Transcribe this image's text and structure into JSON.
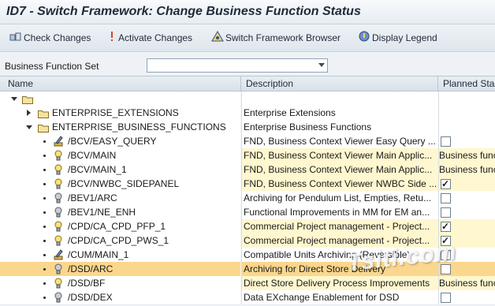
{
  "window": {
    "title": "ID7 - Switch Framework: Change Business Function Status"
  },
  "toolbar": {
    "check_changes": "Check Changes",
    "activate_changes": "Activate Changes",
    "switch_framework_browser": "Switch Framework Browser",
    "display_legend": "Display Legend"
  },
  "bfset": {
    "label": "Business Function Set",
    "value": ""
  },
  "columns": {
    "name": "Name",
    "description": "Description",
    "planned_status": "Planned Sta"
  },
  "tree": {
    "root": {
      "name": "",
      "description": ""
    },
    "enterprise_extensions": {
      "name": "ENTERPRISE_EXTENSIONS",
      "description": "Enterprise Extensions"
    },
    "enterprise_business_functions": {
      "name": "ENTERPRISE_BUSINESS_FUNCTIONS",
      "description": "Enterprise Business Functions"
    }
  },
  "rows": [
    {
      "name": "/BCV/EASY_QUERY",
      "icon": "pencil-icon",
      "description": "FND, Business Context Viewer Easy Query ...",
      "planned": "",
      "checked": false,
      "style": "white"
    },
    {
      "name": "/BCV/MAIN",
      "icon": "bulb-icon",
      "description": "FND, Business Context Viewer Main Applic...",
      "planned": "Business func",
      "checked": null,
      "style": "yellow"
    },
    {
      "name": "/BCV/MAIN_1",
      "icon": "bulb-icon",
      "description": "FND, Business Context Viewer Main Applic...",
      "planned": "Business func",
      "checked": null,
      "style": "yellow"
    },
    {
      "name": "/BCV/NWBC_SIDEPANEL",
      "icon": "bulb-icon",
      "description": "FND, Business Context Viewer NWBC Side ...",
      "planned": "",
      "checked": true,
      "style": "yellow"
    },
    {
      "name": "/BEV1/ARC",
      "icon": "bulb-off-icon",
      "description": "Archiving for Pendulum List, Empties, Retu...",
      "planned": "",
      "checked": false,
      "style": "white"
    },
    {
      "name": "/BEV1/NE_ENH",
      "icon": "bulb-off-icon",
      "description": "Functional Improvements in MM for EM an...",
      "planned": "",
      "checked": false,
      "style": "white"
    },
    {
      "name": "/CPD/CA_CPD_PFP_1",
      "icon": "bulb-icon",
      "description": "Commercial Project management - Project...",
      "planned": "",
      "checked": true,
      "style": "yellow"
    },
    {
      "name": "/CPD/CA_CPD_PWS_1",
      "icon": "bulb-icon",
      "description": "Commercial Project management - Project...",
      "planned": "",
      "checked": true,
      "style": "yellow"
    },
    {
      "name": "/CUM/MAIN_1",
      "icon": "pencil-icon",
      "description": "Compatible Units Archiving (Reversible)",
      "planned": "",
      "checked": false,
      "style": "white"
    },
    {
      "name": "/DSD/ARC",
      "icon": "bulb-off-icon",
      "description": "Archiving for Direct Store Delivery",
      "planned": "",
      "checked": false,
      "style": "sel"
    },
    {
      "name": "/DSD/BF",
      "icon": "bulb-icon",
      "description": "Direct Store Delivery Process Improvements",
      "planned": "Business func",
      "checked": null,
      "style": "yellow"
    },
    {
      "name": "/DSD/DEX",
      "icon": "bulb-off-icon",
      "description": "Data EXchange Enablement for DSD",
      "planned": "",
      "checked": false,
      "style": "white"
    }
  ],
  "watermark": "Tsiti.com",
  "colors": {
    "yellow_row": "#fff7cf",
    "selected_row": "#fbd78d",
    "title_text": "#1f2a38"
  }
}
